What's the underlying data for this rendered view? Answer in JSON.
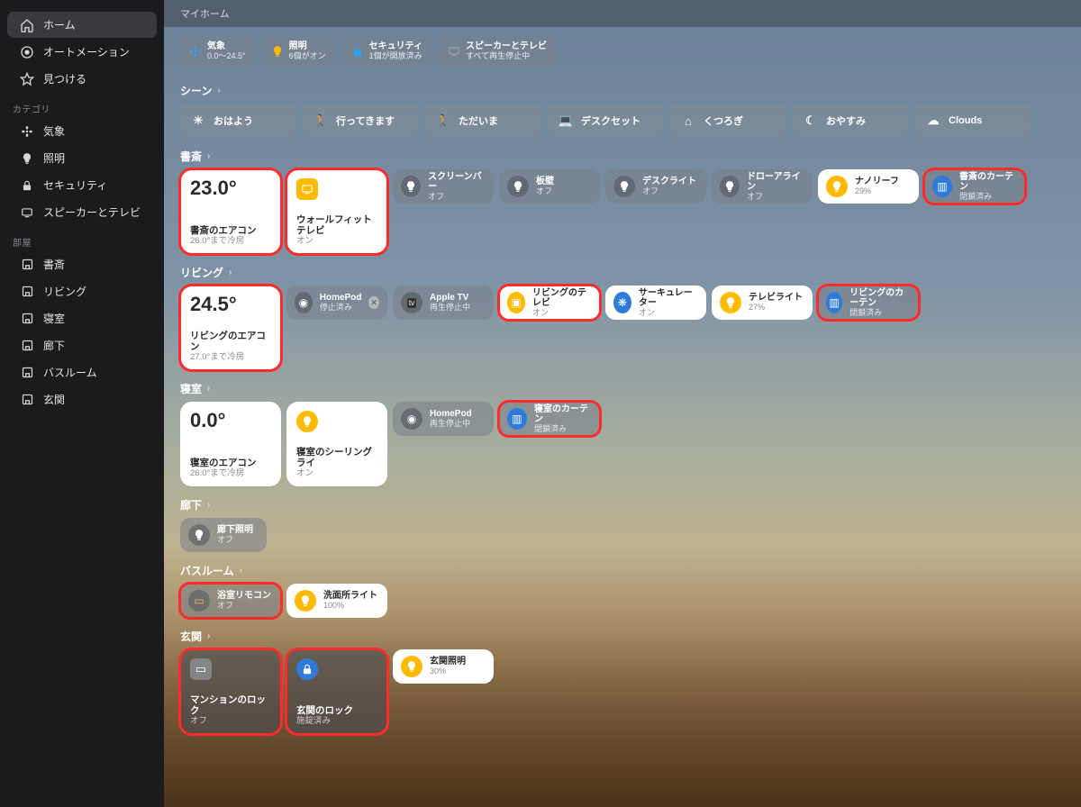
{
  "titlebar": "マイホーム",
  "sidebar": {
    "nav": [
      {
        "icon": "home",
        "label": "ホーム",
        "selected": true
      },
      {
        "icon": "chat",
        "label": "オートメーション",
        "selected": false
      },
      {
        "icon": "star",
        "label": "見つける",
        "selected": false
      }
    ],
    "cat_label": "カテゴリ",
    "categories": [
      {
        "icon": "fan",
        "label": "気象"
      },
      {
        "icon": "bulb",
        "label": "照明"
      },
      {
        "icon": "lock",
        "label": "セキュリティ"
      },
      {
        "icon": "tv",
        "label": "スピーカーとテレビ"
      }
    ],
    "room_label": "部屋",
    "rooms": [
      {
        "label": "書斎"
      },
      {
        "label": "リビング"
      },
      {
        "label": "寝室"
      },
      {
        "label": "廊下"
      },
      {
        "label": "バスルーム"
      },
      {
        "label": "玄関"
      }
    ]
  },
  "status": [
    {
      "icon": "fan",
      "color": "#2fa4ff",
      "t1": "気象",
      "t2": "0.0〜24.5°"
    },
    {
      "icon": "bulb",
      "color": "#ffba00",
      "t1": "照明",
      "t2": "6個がオン"
    },
    {
      "icon": "lock",
      "color": "#2fa4ff",
      "t1": "セキュリティ",
      "t2": "1個が開放済み"
    },
    {
      "icon": "tv",
      "color": "#9aa0a6",
      "t1": "スピーカーとテレビ",
      "t2": "すべて再生停止中"
    }
  ],
  "scene_header": "シーン",
  "scenes": [
    {
      "icon": "☀",
      "label": "おはよう"
    },
    {
      "icon": "🚶",
      "label": "行ってきます"
    },
    {
      "icon": "🚶",
      "label": "ただいま"
    },
    {
      "icon": "💻",
      "label": "デスクセット"
    },
    {
      "icon": "⌂",
      "label": "くつろぎ"
    },
    {
      "icon": "☾",
      "label": "おやすみ"
    },
    {
      "icon": "☁",
      "label": "Clouds"
    }
  ],
  "rooms": {
    "study": {
      "header": "書斎",
      "large": [
        {
          "big": "23.0°",
          "name": "書斎のエアコン",
          "sub": "26.0°まで冷房",
          "hl": true
        },
        {
          "icon": "tv",
          "iconClass": "sq",
          "name": "ウォールフィットテレビ",
          "sub": "オン",
          "hl": true
        }
      ],
      "small": [
        {
          "style": "off",
          "name": "スクリーンバー",
          "sub": "オフ"
        },
        {
          "style": "off",
          "name": "板壁",
          "sub": "オフ"
        },
        {
          "style": "off",
          "name": "デスクライト",
          "sub": "オフ"
        },
        {
          "style": "off",
          "name": "ドローアライン",
          "sub": "オフ"
        },
        {
          "style": "on",
          "name": "ナノリーフ",
          "sub": "29%"
        },
        {
          "style": "off blue",
          "name": "書斎のカーテン",
          "sub": "閉鎖済み",
          "icon": "▥",
          "hl": true
        }
      ]
    },
    "living": {
      "header": "リビング",
      "large": [
        {
          "big": "24.5°",
          "name": "リビングのエアコン",
          "sub": "27.0°まで冷房",
          "hl": true
        }
      ],
      "small": [
        {
          "style": "off music",
          "name": "HomePod",
          "sub": "停止済み",
          "icon": "◉",
          "badge": "✕"
        },
        {
          "style": "off music",
          "name": "Apple TV",
          "sub": "再生停止中",
          "icon": "tv"
        },
        {
          "style": "on",
          "name": "リビングのテレビ",
          "sub": "オン",
          "icon": "▣",
          "hl": true
        },
        {
          "style": "on",
          "name": "サーキュレーター",
          "sub": "オン",
          "icon": "❋",
          "iconBg": "#2f7bdc"
        },
        {
          "style": "on",
          "name": "テレビライト",
          "sub": "27%"
        },
        {
          "style": "off blue",
          "name": "リビングのカーテン",
          "sub": "閉鎖済み",
          "icon": "▥",
          "hl": true
        }
      ]
    },
    "bedroom": {
      "header": "寝室",
      "large": [
        {
          "big": "0.0°",
          "name": "寝室のエアコン",
          "sub": "26.0°まで冷房"
        },
        {
          "icon": "bulb",
          "name": "寝室のシーリングライ",
          "sub": "オン"
        }
      ],
      "small": [
        {
          "style": "off music",
          "name": "HomePod",
          "sub": "再生停止中",
          "icon": "◉"
        },
        {
          "style": "off blue",
          "name": "寝室のカーテン",
          "sub": "閉鎖済み",
          "icon": "▥",
          "hl": true
        }
      ]
    },
    "hallway": {
      "header": "廊下",
      "small": [
        {
          "style": "off mini",
          "name": "廊下照明",
          "sub": "オフ"
        }
      ]
    },
    "bath": {
      "header": "バスルーム",
      "small": [
        {
          "style": "off",
          "name": "浴室リモコン",
          "sub": "オフ",
          "icon": "▭",
          "iconColor": "#f6c15a",
          "hl": true
        },
        {
          "style": "on",
          "name": "洗面所ライト",
          "sub": "100%"
        }
      ]
    },
    "entrance": {
      "header": "玄関",
      "large": [
        {
          "dark": true,
          "icon": "▭",
          "iconClass": "sq gray",
          "name": "マンションのロック",
          "sub": "オフ",
          "hl": true
        },
        {
          "dark": true,
          "icon": "lock",
          "iconClass": "blue",
          "name": "玄関のロック",
          "sub": "施錠済み",
          "hl": true
        }
      ],
      "small": [
        {
          "style": "on",
          "name": "玄関照明",
          "sub": "30%"
        }
      ]
    }
  }
}
